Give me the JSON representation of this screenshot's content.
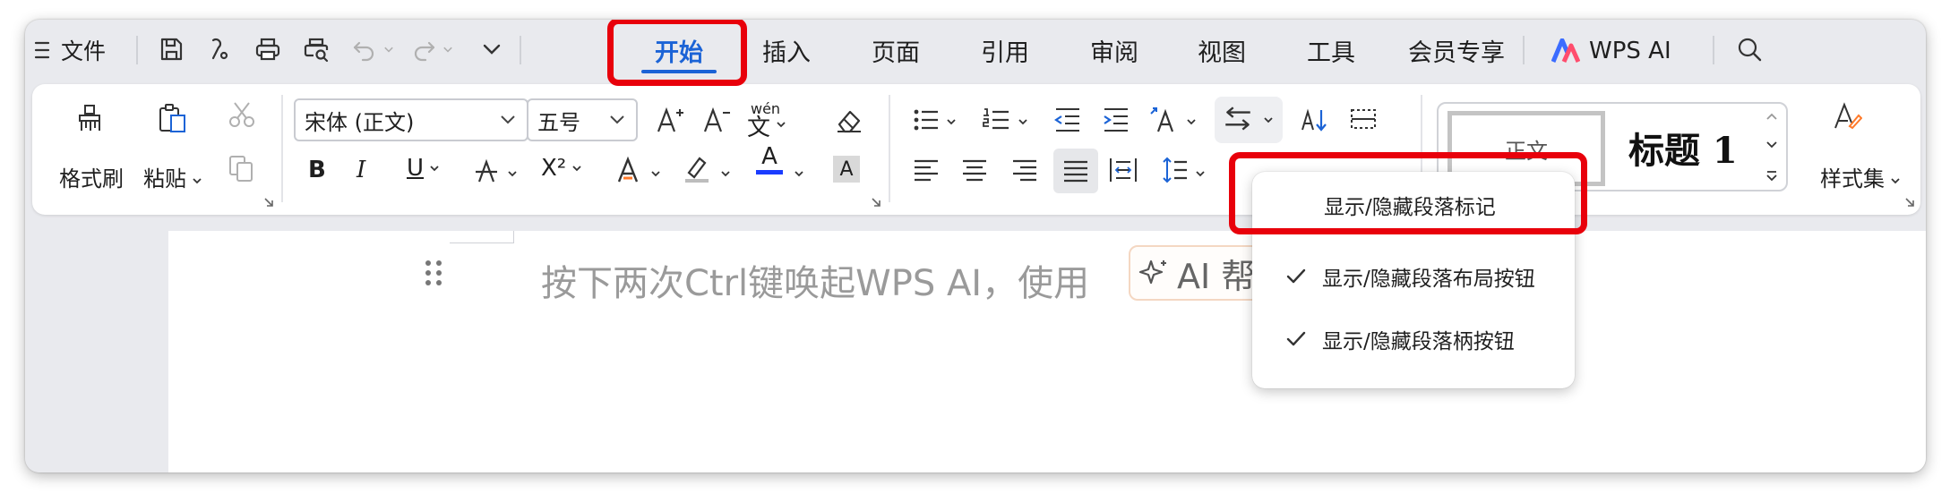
{
  "menu": {
    "hamburger_label": "文件",
    "tabs": [
      "开始",
      "插入",
      "页面",
      "引用",
      "审阅",
      "视图",
      "工具",
      "会员专享"
    ],
    "active_tab": "开始",
    "wps_ai_label": "WPS AI",
    "quick_icons": [
      "save-icon",
      "format-painter-icon",
      "print-icon",
      "print-preview-icon",
      "undo-icon",
      "redo-icon",
      "chevron-down-icon"
    ]
  },
  "ribbon": {
    "format_painter": "格式刷",
    "paste": "粘贴",
    "font_name": "宋体 (正文)",
    "font_size": "五号",
    "phonetic": "wén",
    "bold": "B",
    "italic": "I",
    "underline": "U",
    "superscript": "X²",
    "font_color_letter": "A",
    "highlight_letter": "A",
    "styles": {
      "normal": "正文",
      "heading1": "标题 1"
    },
    "style_set": "样式集"
  },
  "document": {
    "placeholder": "按下两次Ctrl键唤起WPS AI，使用",
    "ai_chip": "AI 帮"
  },
  "popup": {
    "items": [
      {
        "label": "显示/隐藏段落标记",
        "checked": false
      },
      {
        "label": "显示/隐藏段落布局按钮",
        "checked": true
      },
      {
        "label": "显示/隐藏段落柄按钮",
        "checked": true
      }
    ]
  },
  "colors": {
    "accent": "#1b63d6",
    "highlight_frame": "#e8000b",
    "font_color_bar": "#1a3cff",
    "wps_logo_a": "#3b6cff",
    "wps_logo_b": "#ff4d6d"
  }
}
